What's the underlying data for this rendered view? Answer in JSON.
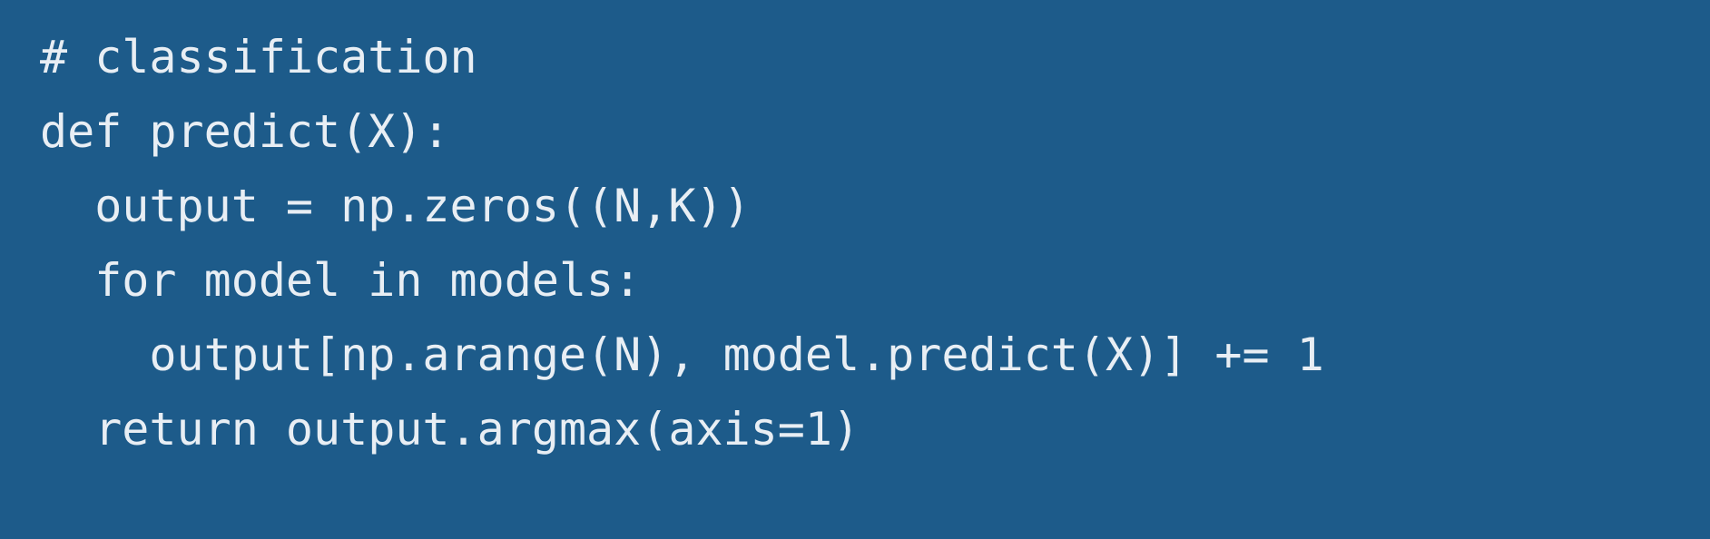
{
  "code": {
    "lines": [
      "# classification",
      "def predict(X):",
      "  output = np.zeros((N,K))",
      "  for model in models:",
      "    output[np.arange(N), model.predict(X)] += 1",
      "  return output.argmax(axis=1)"
    ]
  },
  "colors": {
    "background": "#1d5b8a",
    "text": "#e8eef4"
  }
}
